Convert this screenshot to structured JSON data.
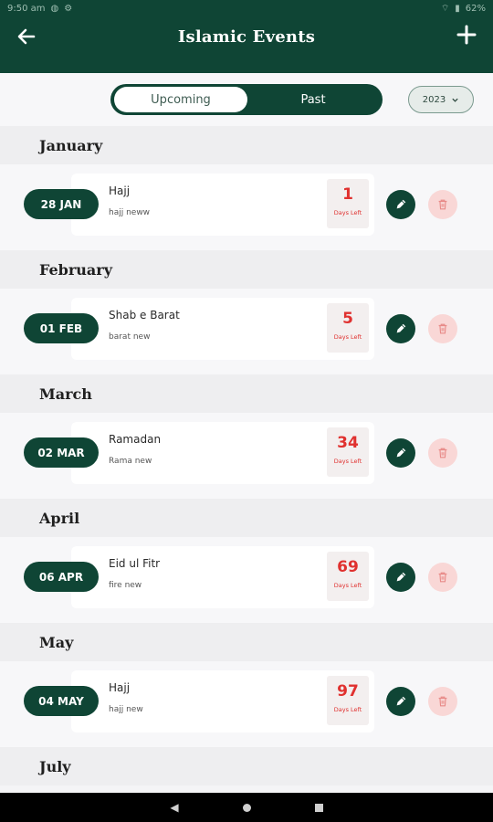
{
  "status_bar": {
    "time": "9:50 am",
    "battery": "62%"
  },
  "app_bar": {
    "title": "Islamic Events",
    "back_icon": "arrow-left-icon",
    "add_icon": "plus-icon"
  },
  "filter": {
    "tabs": [
      {
        "label": "Upcoming",
        "selected": true
      },
      {
        "label": "Past",
        "selected": false
      }
    ],
    "year": "2023"
  },
  "colors": {
    "primary": "#0f4535",
    "accent_red": "#e0312f",
    "delete_bg": "#f9d7d6"
  },
  "months": [
    {
      "name": "January",
      "events": [
        {
          "date": "28 JAN",
          "title": "Hajj",
          "subtitle": "hajj neww",
          "days": "1",
          "days_label": "Days Left"
        }
      ]
    },
    {
      "name": "February",
      "events": [
        {
          "date": "01 FEB",
          "title": "Shab e Barat",
          "subtitle": "barat new",
          "days": "5",
          "days_label": "Days Left"
        }
      ]
    },
    {
      "name": "March",
      "events": [
        {
          "date": "02 MAR",
          "title": "Ramadan",
          "subtitle": "Rama new",
          "days": "34",
          "days_label": "Days Left"
        }
      ]
    },
    {
      "name": "April",
      "events": [
        {
          "date": "06 APR",
          "title": "Eid ul Fitr",
          "subtitle": "fire new",
          "days": "69",
          "days_label": "Days Left"
        }
      ]
    },
    {
      "name": "May",
      "events": [
        {
          "date": "04 MAY",
          "title": "Hajj",
          "subtitle": "hajj new",
          "days": "97",
          "days_label": "Days Left"
        }
      ]
    },
    {
      "name": "July",
      "events": []
    }
  ]
}
